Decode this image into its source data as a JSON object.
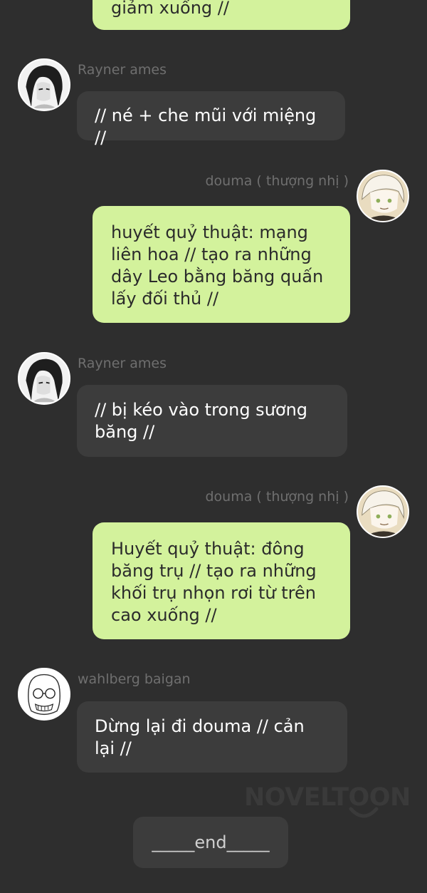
{
  "messages": [
    {
      "side": "right",
      "text": "giảm xuống  //"
    },
    {
      "side": "left",
      "sender": "Rayner ames",
      "avatar": "rayner-avatar",
      "text": "// né + che mũi với miệng //"
    },
    {
      "side": "right",
      "sender": "douma ( thượng nhị )",
      "avatar": "douma-avatar",
      "text": "huyết quỷ thuật: mạng liên hoa // tạo ra những dây Leo bằng băng quấn lấy đối thủ //"
    },
    {
      "side": "left",
      "sender": "Rayner ames",
      "avatar": "rayner-avatar",
      "text": "// bị kéo vào trong sương băng //"
    },
    {
      "side": "right",
      "sender": "douma ( thượng nhị )",
      "avatar": "douma-avatar",
      "text": "Huyết quỷ thuật: đông băng trụ // tạo ra những khối trụ nhọn rơi từ trên cao xuống //"
    },
    {
      "side": "left",
      "sender": "wahlberg baigan",
      "avatar": "wahlberg-avatar",
      "text": "Dừng lại đi douma // cản lại //"
    }
  ],
  "end_label": "_____end_____",
  "watermark": "NOVELTOON",
  "colors": {
    "background": "#2e2e2e",
    "green_bubble": "#d3f29c",
    "dark_bubble": "#3c3c3c",
    "name_text": "#6f6f6f"
  }
}
